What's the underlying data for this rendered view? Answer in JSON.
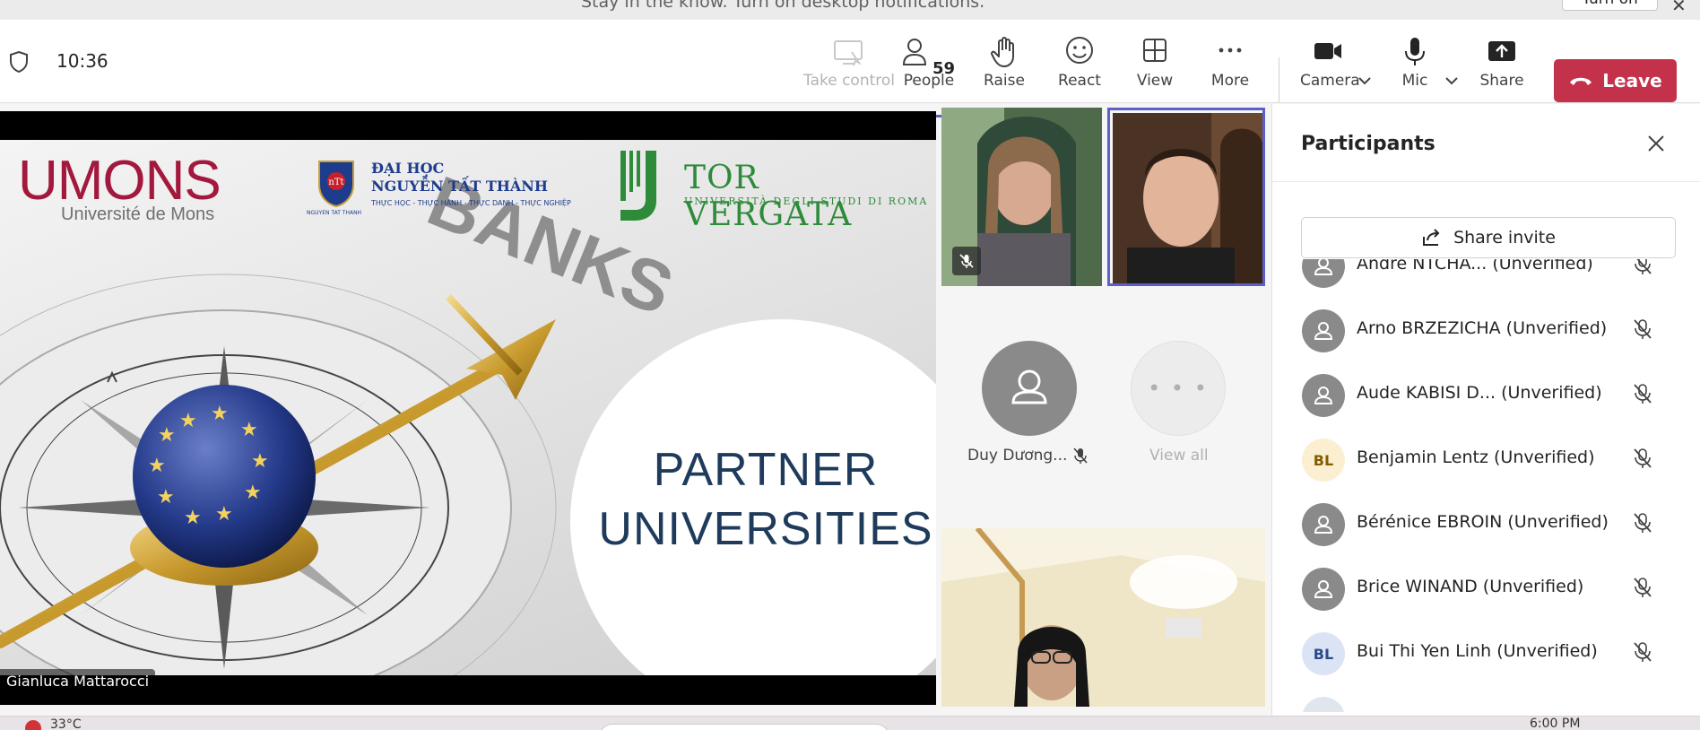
{
  "notification": {
    "text": "Stay in the know. Turn on desktop notifications.",
    "button": "Turn on",
    "close": "✕"
  },
  "toolbar": {
    "time": "10:36",
    "buttons": {
      "take_control": "Take control",
      "people": "People",
      "people_count": "59",
      "raise": "Raise",
      "react": "React",
      "view": "View",
      "more": "More",
      "camera": "Camera",
      "mic": "Mic",
      "share": "Share",
      "leave": "Leave"
    },
    "colors": {
      "accent": "#5b5fc7",
      "leave": "#c4314b"
    }
  },
  "slide": {
    "umons_title": "UMONS",
    "umons_sub": "Université de Mons",
    "ntt_line1": "ĐẠI HỌC",
    "ntt_line2": "NGUYỄN TẤT THÀNH",
    "ntt_line3": "THỰC HỌC - THỰC HÀNH - THỰC DANH - THỰC NGHIỆP",
    "ntt_under": "NGUYEN TAT THANH",
    "tv_line1": "TOR VERGATA",
    "tv_line2": "UNIVERSITÀ DEGLI STUDI DI ROMA",
    "partner_line1": "PARTNER",
    "partner_line2": "UNIVERSITIES",
    "presenter": "Gianluca Mattarocci"
  },
  "tiles": {
    "duy_name": "Duy Dương...",
    "view_all": "View all"
  },
  "panel": {
    "title": "Participants",
    "share_invite": "Share invite",
    "participants": [
      {
        "name": "Andre NTCHA...",
        "status": "(Unverified)",
        "initials": "",
        "avatar": "generic"
      },
      {
        "name": "Arno BRZEZICHA",
        "status": "(Unverified)",
        "initials": "",
        "avatar": "generic"
      },
      {
        "name": "Aude KABISI D...",
        "status": "(Unverified)",
        "initials": "",
        "avatar": "generic"
      },
      {
        "name": "Benjamin Lentz",
        "status": "(Unverified)",
        "initials": "BL",
        "avatar": "bl1"
      },
      {
        "name": "Bérénice EBROIN",
        "status": "(Unverified)",
        "initials": "",
        "avatar": "generic"
      },
      {
        "name": "Brice WINAND",
        "status": "(Unverified)",
        "initials": "",
        "avatar": "generic"
      },
      {
        "name": "Bui Thi Yen Linh",
        "status": "(Unverified)",
        "initials": "BL",
        "avatar": "bl2"
      }
    ]
  },
  "taskbar": {
    "weather": "33°C",
    "time": "6:00 PM"
  }
}
